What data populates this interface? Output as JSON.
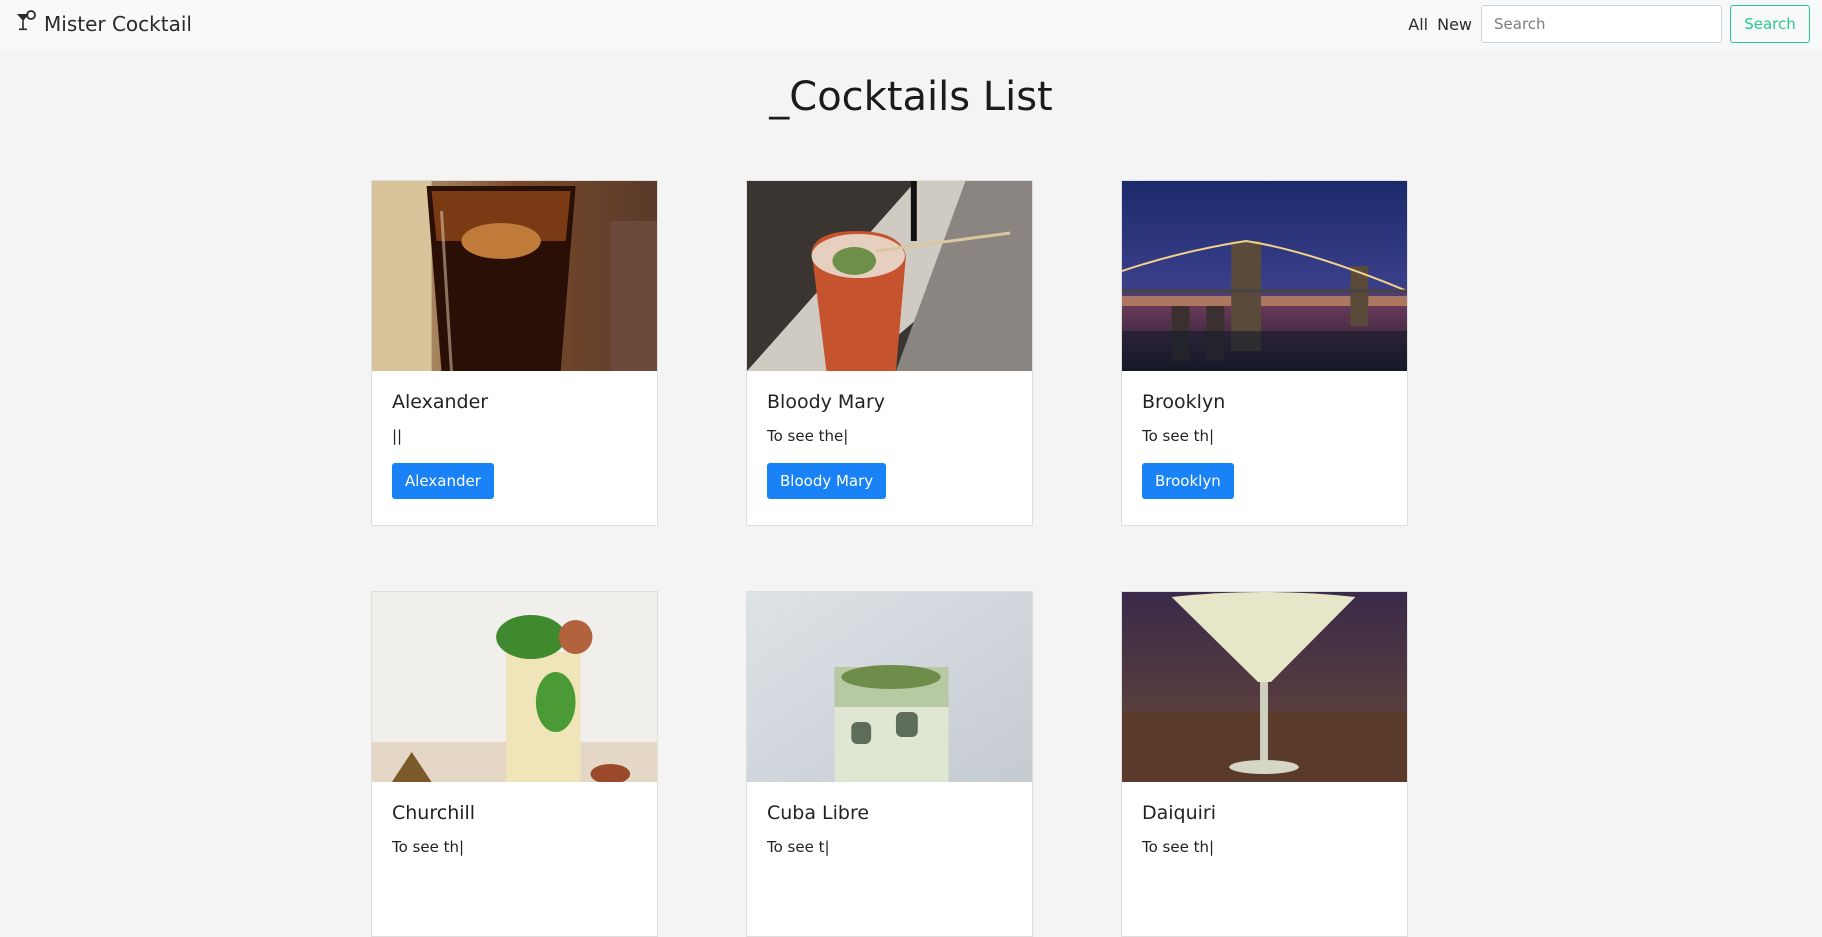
{
  "navbar": {
    "brand": "Mister Cocktail",
    "brand_icon": "cocktail-glass-icon",
    "links": [
      "All",
      "New"
    ],
    "search_placeholder": "Search",
    "search_button": "Search"
  },
  "page_title": "_Cocktails List",
  "cards": [
    {
      "title": "Alexander",
      "text": "||",
      "button": "Alexander",
      "image": "dark-rum-glass-photo"
    },
    {
      "title": "Bloody Mary",
      "text": "To see the|",
      "button": "Bloody Mary",
      "image": "bloody-mary-photo"
    },
    {
      "title": "Brooklyn",
      "text": "To see th|",
      "button": "Brooklyn",
      "image": "brooklyn-bridge-photo"
    },
    {
      "title": "Churchill",
      "text": "To see th|",
      "button": "",
      "image": "mint-cocktail-photo"
    },
    {
      "title": "Cuba Libre",
      "text": "To see t|",
      "button": "",
      "image": "green-cocktail-photo"
    },
    {
      "title": "Daiquiri",
      "text": "To see th|",
      "button": "",
      "image": "daiquiri-photo"
    }
  ],
  "colors": {
    "accent_button": "#1a82f7",
    "search_outline": "#28c98a",
    "page_bg": "#f4f4f4"
  }
}
